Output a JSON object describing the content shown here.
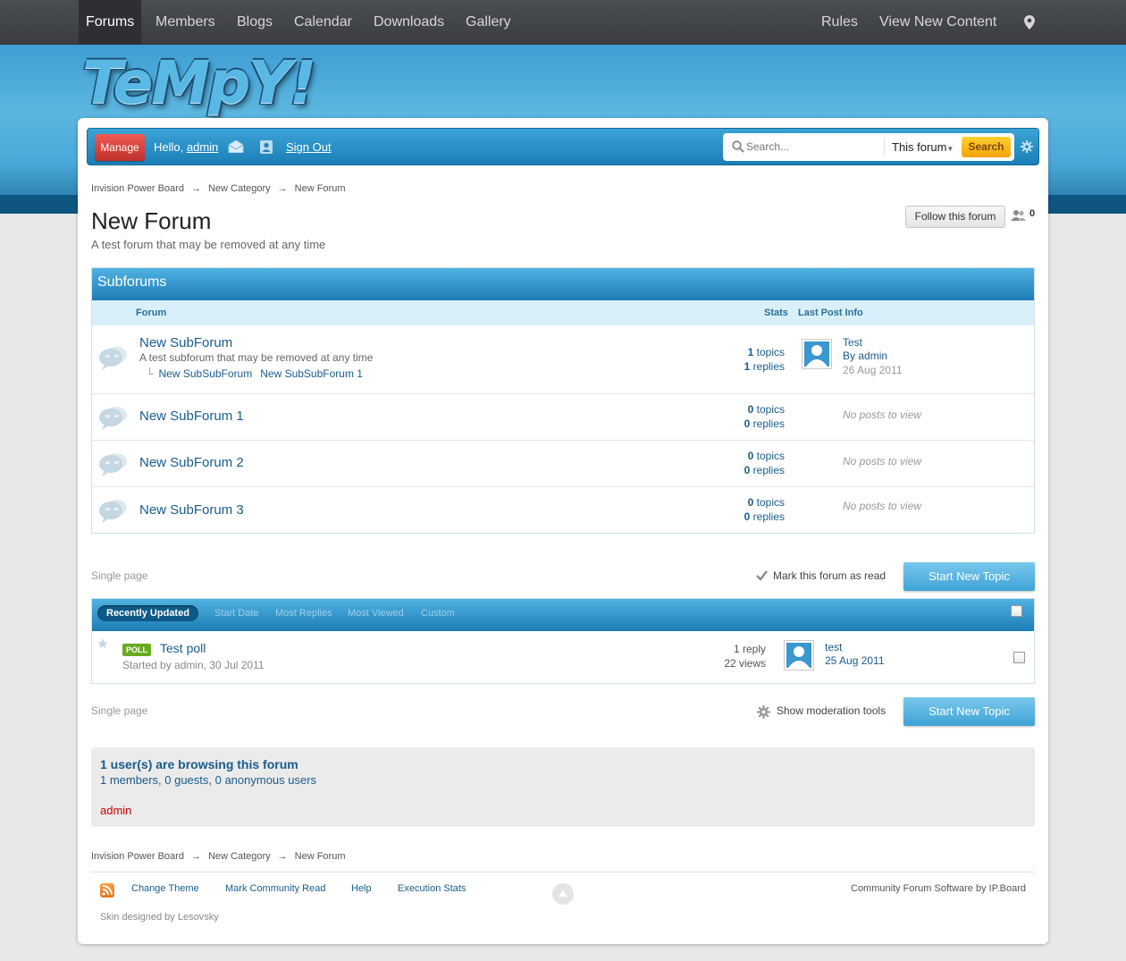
{
  "topnav": {
    "left": [
      "Forums",
      "Members",
      "Blogs",
      "Calendar",
      "Downloads",
      "Gallery"
    ],
    "right": [
      "Rules",
      "View New Content"
    ],
    "active": "Forums"
  },
  "logo": "TeMpY!",
  "userbar": {
    "manage": "Manage",
    "hello": "Hello, ",
    "username": "admin",
    "signout": "Sign Out"
  },
  "search": {
    "placeholder": "Search...",
    "scope": "This forum",
    "button": "Search"
  },
  "breadcrumb": [
    "Invision Power Board",
    "New Category",
    "New Forum"
  ],
  "breadcrumb_arrow": "→",
  "page": {
    "title": "New Forum",
    "description": "A test forum that may be removed at any time",
    "follow": "Follow this forum",
    "followers": "0"
  },
  "subforums": {
    "title": "Subforums",
    "col_forum": "Forum",
    "col_stats": "Stats",
    "col_last": "Last Post Info",
    "rows": [
      {
        "title": "New SubForum",
        "desc": "A test subforum that may be removed at any time",
        "children": [
          "New SubSubForum",
          "New SubSubForum 1"
        ],
        "topics": "1",
        "replies": "1",
        "last_title": "Test",
        "last_by_prefix": "By ",
        "last_by": "admin",
        "last_date": "26 Aug 2011"
      },
      {
        "title": "New SubForum 1",
        "topics": "0",
        "replies": "0",
        "noposts": "No posts to view"
      },
      {
        "title": "New SubForum 2",
        "topics": "0",
        "replies": "0",
        "noposts": "No posts to view"
      },
      {
        "title": "New SubForum 3",
        "topics": "0",
        "replies": "0",
        "noposts": "No posts to view"
      }
    ],
    "topics_word": " topics",
    "replies_word": " replies"
  },
  "pagination": "Single page",
  "mark_read": "Mark this forum as read",
  "start_topic": "Start New Topic",
  "topics": {
    "tabs": [
      "Recently Updated",
      "Start Date",
      "Most Replies",
      "Most Viewed",
      "Custom"
    ],
    "rows": [
      {
        "badge": "POLL",
        "title": "Test poll",
        "started": "Started by admin, 30 Jul 2011",
        "replies": "1 reply",
        "views": "22 views",
        "last_user": "test",
        "last_date": "25 Aug 2011"
      }
    ]
  },
  "mod_tools": "Show moderation tools",
  "browsing": {
    "title": "1 user(s) are browsing this forum",
    "counts": "1 members, 0 guests, 0 anonymous users",
    "users": "admin"
  },
  "footer": {
    "links": [
      "Change Theme",
      "Mark Community Read",
      "Help",
      "Execution Stats"
    ],
    "powered": "Community Forum Software by IP.Board",
    "skin": "Skin designed by Lesovsky"
  },
  "colors": {
    "accent": "#1d7db5",
    "link": "#1a5c8c",
    "manage": "#d9403a",
    "search_button": "#f7b619",
    "poll_badge": "#6aaa1f",
    "online_user": "#cc0000"
  }
}
